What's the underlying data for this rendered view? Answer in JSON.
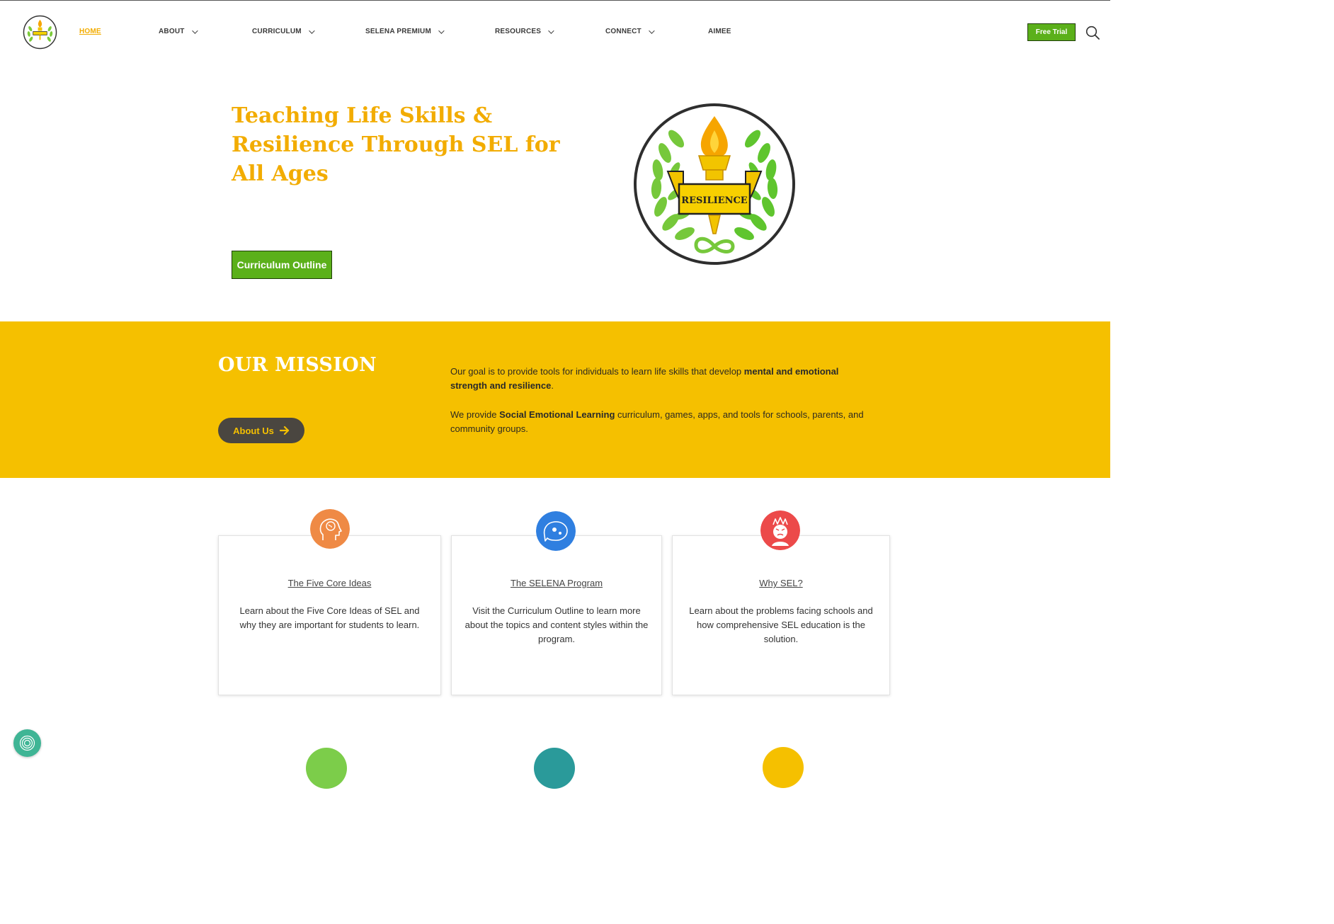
{
  "nav": {
    "items": [
      {
        "label": "HOME",
        "active": true,
        "dropdown": false
      },
      {
        "label": "ABOUT",
        "active": false,
        "dropdown": true
      },
      {
        "label": "CURRICULUM",
        "active": false,
        "dropdown": true
      },
      {
        "label": "SELENA PREMIUM",
        "active": false,
        "dropdown": true
      },
      {
        "label": "RESOURCES",
        "active": false,
        "dropdown": true
      },
      {
        "label": "CONNECT",
        "active": false,
        "dropdown": true
      },
      {
        "label": "AIMEE",
        "active": false,
        "dropdown": false
      }
    ],
    "free_trial": "Free Trial",
    "search_icon": "search-icon"
  },
  "hero": {
    "title": "Teaching Life Skills & Resilience Through SEL for All Ages",
    "button": "Curriculum Outline",
    "emblem_label": "RESILIENCE"
  },
  "mission": {
    "title": "OUR MISSION",
    "button": "About Us",
    "p1_a": "Our goal is to provide tools for individuals to learn life skills that develop ",
    "p1_b": "mental and emotional strength and resilience",
    "p1_c": ".",
    "p2_a": "We provide ",
    "p2_b": "Social Emotional Learning",
    "p2_c": " curriculum, games, apps, and tools for schools, parents, and community groups."
  },
  "cards": [
    {
      "title": "The Five Core Ideas",
      "desc": "Learn about the Five Core Ideas of SEL and why they are important for students to learn.",
      "icon": "brain-head-icon"
    },
    {
      "title": "The SELENA Program",
      "desc": "Visit the Curriculum Outline to learn more about the topics and content styles within the program.",
      "icon": "thought-bubble-icon"
    },
    {
      "title": "Why SEL?",
      "desc": "Learn about the problems facing schools and how comprehensive SEL education is the solution.",
      "icon": "angry-face-icon"
    }
  ],
  "colors": {
    "accent_yellow": "#f2ac00",
    "mission_bg": "#f5c000",
    "green": "#5bb01a",
    "dark_button": "#4a4640"
  }
}
